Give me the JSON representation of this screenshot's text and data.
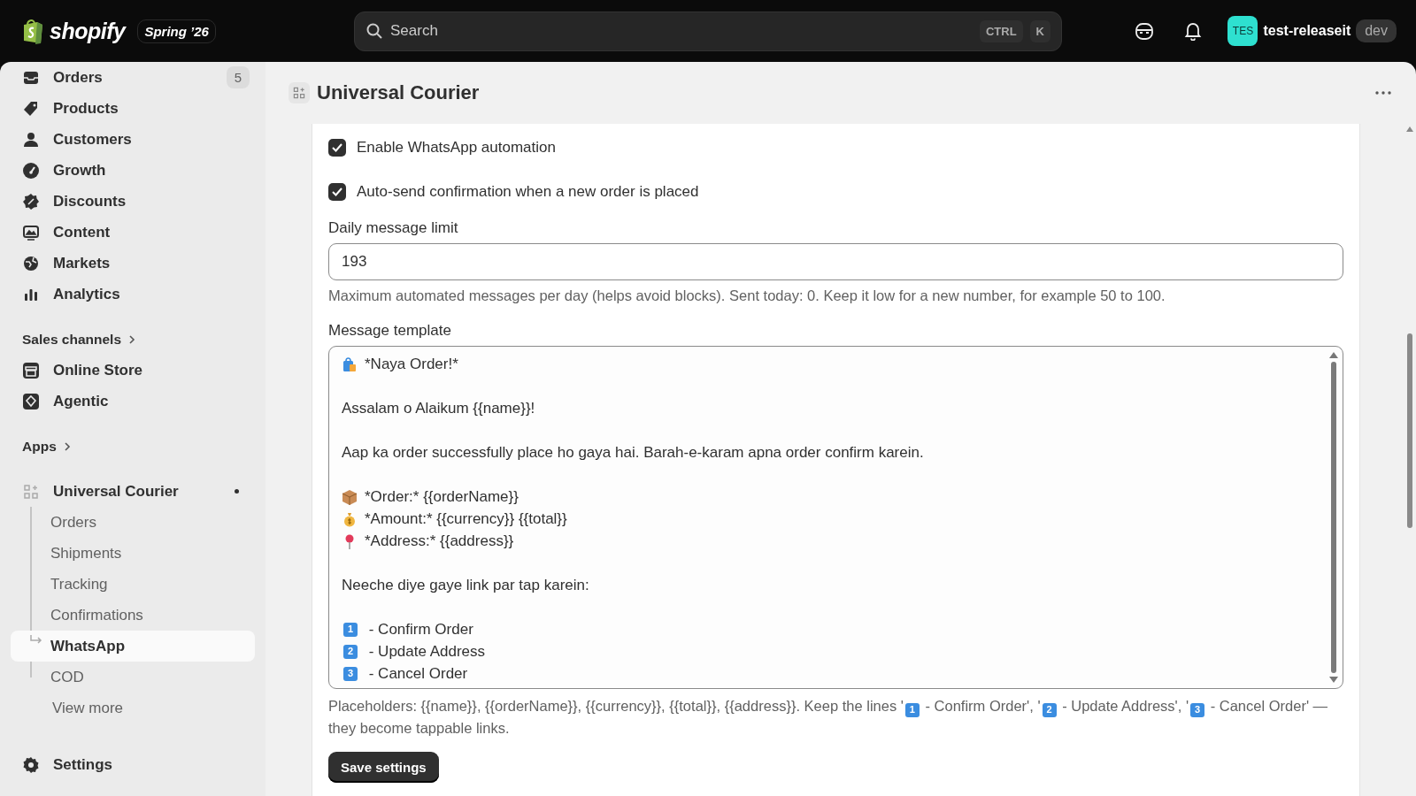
{
  "topbar": {
    "brand": "shopify",
    "edition": "Spring ’26",
    "search": {
      "placeholder": "Search",
      "keys": [
        "CTRL",
        "K"
      ]
    },
    "avatar": "TES",
    "store": "test-releaseit",
    "store_badge": "dev"
  },
  "sidebar": {
    "items": [
      {
        "label": "Orders",
        "badge": "5"
      },
      {
        "label": "Products"
      },
      {
        "label": "Customers"
      },
      {
        "label": "Growth"
      },
      {
        "label": "Discounts"
      },
      {
        "label": "Content"
      },
      {
        "label": "Markets"
      },
      {
        "label": "Analytics"
      }
    ],
    "sales_channels": {
      "heading": "Sales channels",
      "items": [
        {
          "label": "Online Store"
        },
        {
          "label": "Agentic"
        }
      ]
    },
    "apps": {
      "heading": "Apps",
      "app": {
        "label": "Universal Courier",
        "pinned": true,
        "children": [
          {
            "label": "Orders",
            "selected": false
          },
          {
            "label": "Shipments",
            "selected": false
          },
          {
            "label": "Tracking",
            "selected": false
          },
          {
            "label": "Confirmations",
            "selected": false
          },
          {
            "label": "WhatsApp",
            "selected": true
          },
          {
            "label": "COD",
            "selected": false
          }
        ]
      },
      "more": "View more"
    },
    "settings": "Settings"
  },
  "page": {
    "title": "Universal Courier",
    "form": {
      "checkboxes": [
        {
          "label": "Enable WhatsApp automation",
          "checked": true
        },
        {
          "label": "Auto-send confirmation when a new order is placed",
          "checked": true
        }
      ],
      "limit": {
        "label": "Daily message limit",
        "value": "193",
        "help": "Maximum automated messages per day (helps avoid blocks). Sent today: 0. Keep it low for a new number, for example 50 to 100."
      },
      "template": {
        "label": "Message template",
        "lines": [
          {
            "kind": "bullet",
            "text": "*Naya Order!*"
          },
          {
            "kind": "blank"
          },
          {
            "kind": "plain",
            "text": "Assalam o Alaikum {{name}}!"
          },
          {
            "kind": "blank"
          },
          {
            "kind": "plain",
            "text": "Aap ka order successfully place ho gaya hai. Barah-e-karam apna order confirm karein."
          },
          {
            "kind": "blank"
          },
          {
            "kind": "bullet",
            "text": "*Order:* {{orderName}}"
          },
          {
            "kind": "bullet",
            "text": "*Amount:* {{currency}} {{total}}"
          },
          {
            "kind": "bullet",
            "text": "*Address:* {{address}}"
          },
          {
            "kind": "blank"
          },
          {
            "kind": "plain",
            "text": "Neeche diye gaye link par tap karein:"
          },
          {
            "kind": "blank"
          },
          {
            "kind": "keycap",
            "key": "1",
            "text": " - Confirm Order"
          },
          {
            "kind": "keycap",
            "key": "2",
            "text": " - Update Address"
          },
          {
            "kind": "keycap",
            "key": "3",
            "text": " - Cancel Order"
          }
        ],
        "hint": [
          {
            "text": "Placeholders: {{name}}, {{orderName}}, {{currency}}, {{total}}, {{address}}. Keep the lines '"
          },
          {
            "key": "1"
          },
          {
            "text": " - Confirm Order', '"
          },
          {
            "key": "2"
          },
          {
            "text": " - Update Address', '"
          },
          {
            "key": "3"
          },
          {
            "text": " - Cancel Order' — they become tappable links."
          }
        ]
      },
      "save": "Save settings"
    }
  }
}
